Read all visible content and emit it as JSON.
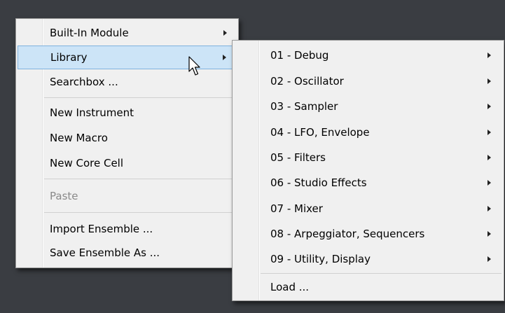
{
  "main_menu": {
    "built_in_module": "Built-In Module",
    "library": "Library",
    "searchbox": "Searchbox ...",
    "new_instrument": "New Instrument",
    "new_macro": "New Macro",
    "new_core_cell": "New Core Cell",
    "paste": "Paste",
    "import_ensemble": "Import Ensemble ...",
    "save_ensemble_as": "Save Ensemble As ..."
  },
  "library_menu": {
    "items": [
      "01 - Debug",
      "02 - Oscillator",
      "03 - Sampler",
      "04 - LFO, Envelope",
      "05 - Filters",
      "06 - Studio Effects",
      "07 - Mixer",
      "08 - Arpeggiator, Sequencers",
      "09 - Utility, Display"
    ],
    "load": "Load ..."
  },
  "colors": {
    "background": "#3a3d42",
    "menu": "#f0f0f0",
    "highlight": "#cce4f7",
    "highlight_border": "#7fb2de",
    "disabled_text": "#8a8a8a"
  },
  "icons": [
    "submenu-arrow-icon",
    "mouse-pointer-icon"
  ]
}
